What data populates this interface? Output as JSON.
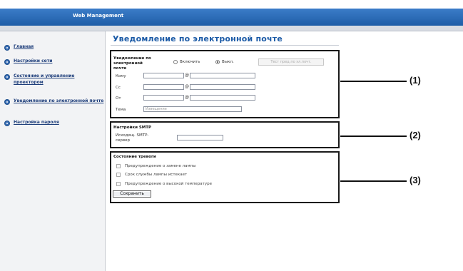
{
  "header": {
    "title": "Web Management"
  },
  "sidebar": {
    "items": [
      {
        "label": "Главная"
      },
      {
        "label": "Настройки сети"
      },
      {
        "label": "Состояние и управление проектором"
      },
      {
        "label": "Уведомление по электронной почте"
      },
      {
        "label": "Настройка пароля"
      }
    ]
  },
  "page": {
    "title": "Уведомление по электронной почте"
  },
  "email_section": {
    "notify_label": "Уведомление по электронной почте",
    "radio_on": "Включить",
    "radio_off": "Выкл.",
    "radio_selected": "off",
    "test_button": "Тест пред.по эл.почт.",
    "to_label": "Кому",
    "cc_label": "Cc",
    "from_label": "От",
    "subject_label": "Тема",
    "subject_placeholder": "Извещение",
    "at_sign": "@"
  },
  "smtp_section": {
    "title": "Настройки SMTP",
    "server_label": "Исходящ. SMTP-сервер"
  },
  "alarm_section": {
    "title": "Состояние тревоги",
    "items": [
      {
        "label": "Предупреждение о замене лампы",
        "checked": false
      },
      {
        "label": "Срок службы лампы истекает",
        "checked": false
      },
      {
        "label": "Предупреждение о высокой температуре",
        "checked": false
      }
    ],
    "save_button": "Сохранить"
  },
  "callouts": [
    "(1)",
    "(2)",
    "(3)"
  ]
}
